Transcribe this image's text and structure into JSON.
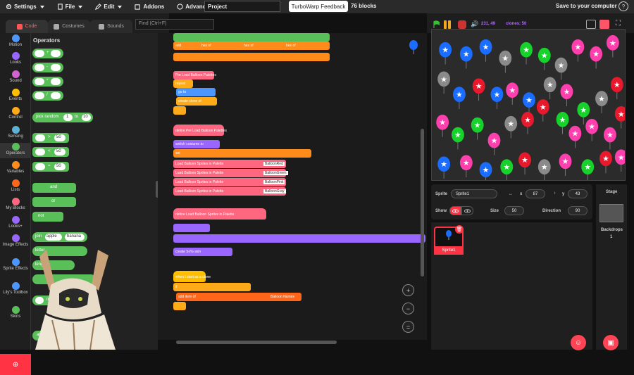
{
  "menu": {
    "settings": "Settings",
    "file": "File",
    "edit": "Edit",
    "addons": "Addons",
    "advanced": "Advanced",
    "project_title": "Project",
    "feedback": "TurboWarp Feedback",
    "block_count": "76 blocks",
    "save": "Save to your computer"
  },
  "tabs": {
    "code": "Code",
    "costumes": "Costumes",
    "sounds": "Sounds"
  },
  "find": {
    "placeholder": "Find (Ctrl+F)"
  },
  "categories": [
    {
      "label": "Motion",
      "color": "#4c97ff"
    },
    {
      "label": "Looks",
      "color": "#9966ff"
    },
    {
      "label": "Sound",
      "color": "#cf63cf"
    },
    {
      "label": "Events",
      "color": "#ffbf00"
    },
    {
      "label": "Control",
      "color": "#ffab19"
    },
    {
      "label": "Sensing",
      "color": "#5cb1d6"
    },
    {
      "label": "Operators",
      "color": "#59c059"
    },
    {
      "label": "Variables",
      "color": "#ff8c1a"
    },
    {
      "label": "Lists",
      "color": "#ff661a"
    },
    {
      "label": "My Blocks",
      "color": "#ff6680"
    },
    {
      "label": "Looks+",
      "color": "#9966ff"
    },
    {
      "label": "Image Effects",
      "color": "#9966ff"
    },
    {
      "label": "Sprite Effects",
      "color": "#4c97ff"
    },
    {
      "label": "Lily's Toolbox",
      "color": "#4c97ff"
    },
    {
      "label": "Skins",
      "color": "#59c059"
    }
  ],
  "palette": {
    "title": "Operators",
    "pick_random": "pick random",
    "to": "to",
    "rand_a": "1",
    "rand_b": "10",
    "cmp_value": "50",
    "and": "and",
    "or": "or",
    "not": "not",
    "join": "join",
    "join_a": "apple",
    "join_b": "banana",
    "letter": "letter",
    "length": "length",
    "mod": "mod",
    "abs": "abs"
  },
  "code": {
    "preload_palettes": "Pre Load Balloon Palettes",
    "repeat": "repeat",
    "repeat_n": "10",
    "go_to": "go to",
    "random_position": "random position",
    "create_clone": "create clone of",
    "myself": "myself",
    "define_preload": "define Pre Load Balloon Palettes",
    "switch_costume": "switch costume to",
    "balloon2": "Balloon-2",
    "set_var": "set",
    "to": "to",
    "load_sprites": "Load Balloon Sprites in Palette",
    "define_load": "define Load Balloon Sprites in Palette",
    "palette_word": "palette",
    "save_name": "SaveName",
    "define_clone": "when I start as a clone",
    "if_word": "if",
    "pick_random": "pick random",
    "then": "then",
    "add_item": "add item of",
    "balloon_names": "Balloon Names",
    "balloon_red": "BalloonRed",
    "balloon_green": "BalloonGreen",
    "balloon_pink": "BalloonPink",
    "balloon_gray": "BalloonGray",
    "create_svg": "create SVG skin",
    "pal_col": "Palette",
    "item_num": "item",
    "add": "add",
    "join": "join",
    "hex_of": "hex of",
    "to_word": "to"
  },
  "stage": {
    "fps": "231, 49",
    "clones": "clones: 50"
  },
  "sprite": {
    "label": "Sprite",
    "name": "Sprite1",
    "x_label": "x",
    "x": "87",
    "y_label": "y",
    "y": "43",
    "show": "Show",
    "size_label": "Size",
    "size": "50",
    "direction_label": "Direction",
    "direction": "90",
    "tile_name": "Sprite1"
  },
  "stage_panel": {
    "title": "Stage",
    "backdrops_label": "Backdrops",
    "backdrops": "1"
  },
  "balloon_colors": {
    "red": "#e8192c",
    "pink": "#ff3fae",
    "blue": "#1a6dff",
    "green": "#17d22a",
    "gray": "#8a8a8a"
  }
}
